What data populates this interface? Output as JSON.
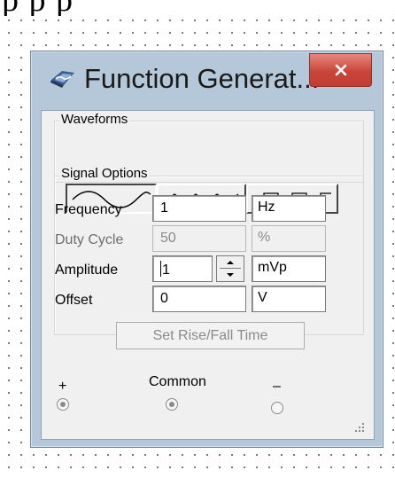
{
  "header_text": "p   p   p",
  "window": {
    "title": "Function Generat...",
    "app_icon": "function-generator-icon",
    "close_icon": "close-icon"
  },
  "waveforms": {
    "label": "Waveforms",
    "buttons": [
      {
        "name": "sine",
        "icon": "sine-wave-icon",
        "selected": true
      },
      {
        "name": "triangle",
        "icon": "triangle-wave-icon",
        "selected": false
      },
      {
        "name": "square",
        "icon": "square-wave-icon",
        "selected": false
      }
    ]
  },
  "signal_options": {
    "label": "Signal Options",
    "frequency": {
      "label": "Frequency",
      "value": "1",
      "unit": "Hz"
    },
    "duty_cycle": {
      "label": "Duty Cycle",
      "value": "50",
      "unit": "%",
      "enabled": false
    },
    "amplitude": {
      "label": "Amplitude",
      "value": "1",
      "unit": "mVp"
    },
    "offset": {
      "label": "Offset",
      "value": "0",
      "unit": "V"
    }
  },
  "set_rise_fall_label": "Set Rise/Fall Time",
  "terminals": {
    "plus_label": "+",
    "common_label": "Common",
    "minus_label": "–"
  },
  "colors": {
    "frame": "#b5c8da",
    "close_button": "#c8453a",
    "client_bg": "#f0f0f0"
  }
}
